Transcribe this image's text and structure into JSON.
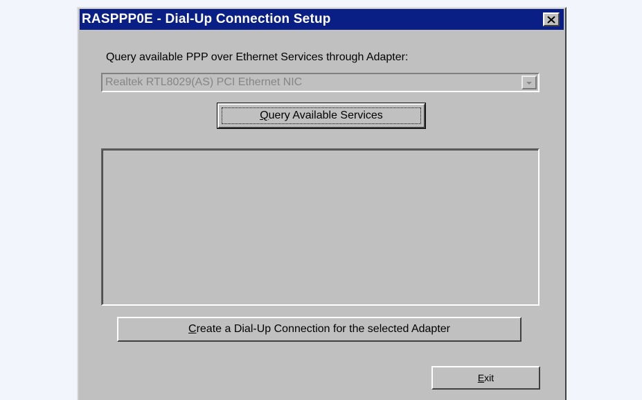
{
  "window": {
    "title": "RASPPP0E - Dial-Up Connection Setup"
  },
  "query": {
    "label": "Query available PPP over Ethernet Services through Adapter:"
  },
  "adapter_select": {
    "selected": "Realtek RTL8029(AS) PCI Ethernet NIC",
    "disabled": true
  },
  "buttons": {
    "query": {
      "mnemonic": "Q",
      "rest": "uery Available Services"
    },
    "create": {
      "mnemonic": "C",
      "rest": "reate a Dial-Up Connection for the selected Adapter"
    },
    "exit": {
      "mnemonic": "E",
      "rest": "xit"
    }
  },
  "services_list": {
    "items": []
  },
  "colors": {
    "titlebar": "#0a1f86",
    "face": "#c0c0c0",
    "disabled_text": "#858585"
  },
  "icons": {
    "close": "close-icon",
    "dropdown": "chevron-down-icon"
  }
}
